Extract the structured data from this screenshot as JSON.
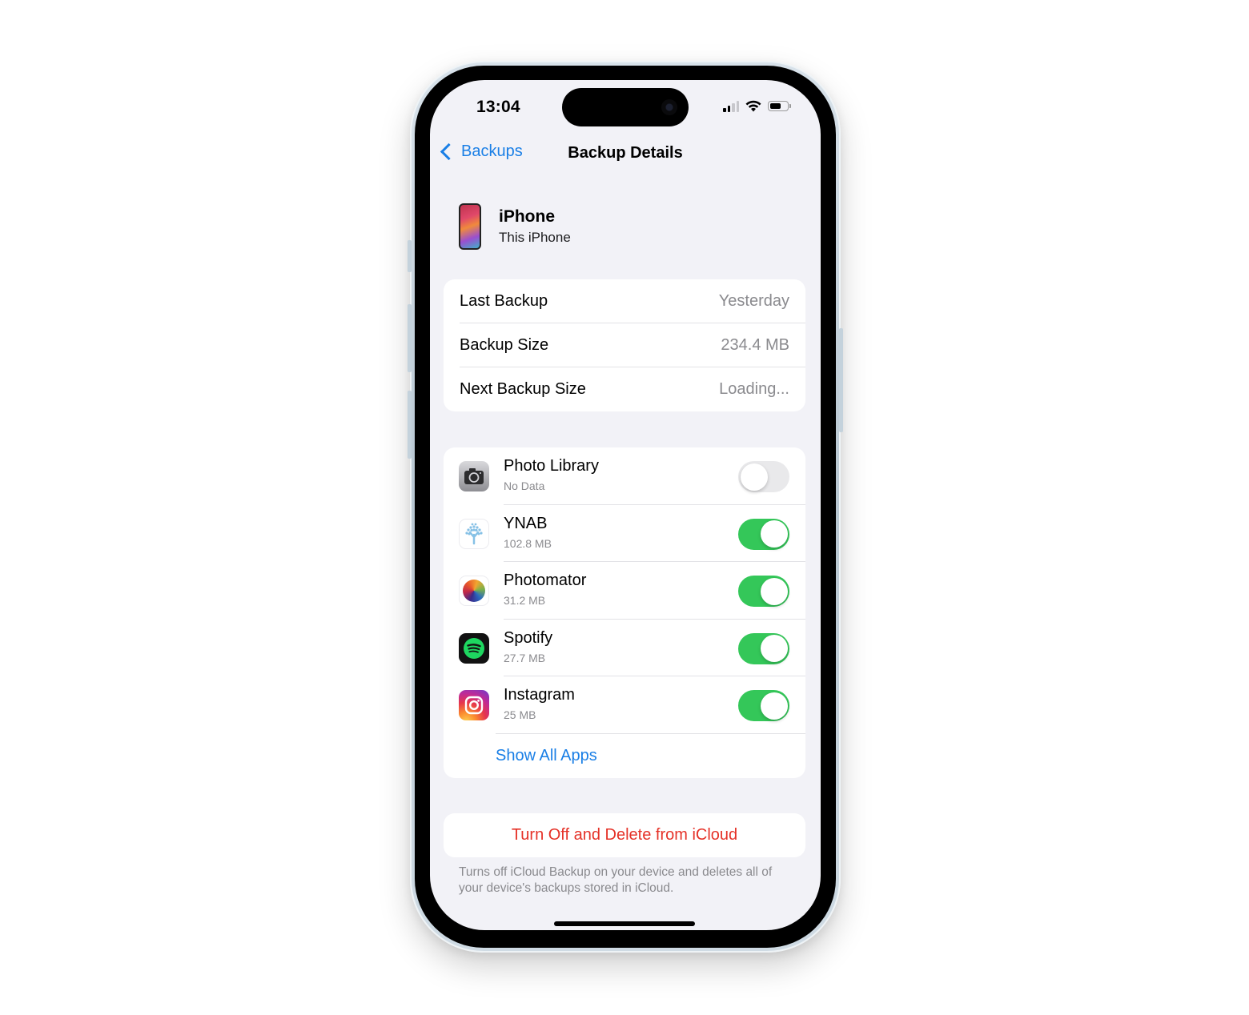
{
  "status_bar": {
    "time": "13:04",
    "signal_bars_active": 2,
    "signal_bars_total": 4,
    "wifi": "wifi-icon",
    "battery_level": 0.65
  },
  "nav": {
    "back_label": "Backups",
    "title": "Backup Details"
  },
  "device": {
    "name": "iPhone",
    "subtitle": "This iPhone"
  },
  "info": [
    {
      "label": "Last Backup",
      "value": "Yesterday"
    },
    {
      "label": "Backup Size",
      "value": "234.4 MB"
    },
    {
      "label": "Next Backup Size",
      "value": "Loading..."
    }
  ],
  "apps": [
    {
      "name": "Photo Library",
      "size": "No Data",
      "icon": "camera-icon",
      "enabled": false
    },
    {
      "name": "YNAB",
      "size": "102.8 MB",
      "icon": "ynab-icon",
      "enabled": true
    },
    {
      "name": "Photomator",
      "size": "31.2 MB",
      "icon": "photomator-icon",
      "enabled": true
    },
    {
      "name": "Spotify",
      "size": "27.7 MB",
      "icon": "spotify-icon",
      "enabled": true
    },
    {
      "name": "Instagram",
      "size": "25 MB",
      "icon": "instagram-icon",
      "enabled": true
    }
  ],
  "show_all_label": "Show All Apps",
  "delete_button_label": "Turn Off and Delete from iCloud",
  "footnote": "Turns off iCloud Backup on your device and deletes all of your device's backups stored in iCloud.",
  "colors": {
    "accent": "#1a7fe6",
    "toggle_on": "#34c759",
    "destructive": "#e53228",
    "background": "#f2f2f7"
  }
}
